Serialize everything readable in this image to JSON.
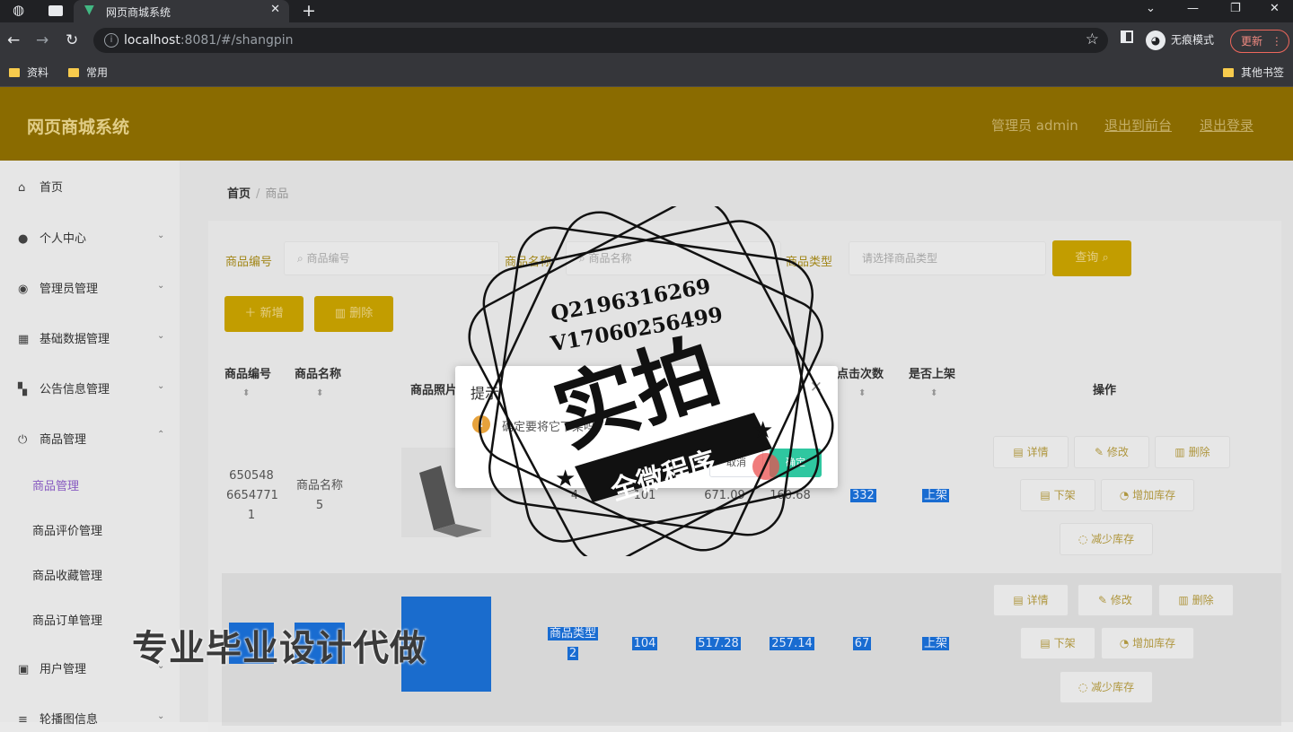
{
  "browser": {
    "tab_title": "网页商城系统",
    "url_host": "localhost",
    "url_rest": ":8081/#/shangpin",
    "incognito_label": "无痕模式",
    "update_label": "更新",
    "bookmarks": [
      "资料",
      "常用"
    ],
    "other_bookmarks": "其他书签"
  },
  "header": {
    "title": "网页商城系统",
    "admin": "管理员 admin",
    "back_front": "退出到前台",
    "logout": "退出登录"
  },
  "sidebar": {
    "items": [
      {
        "label": "首页",
        "icon": "home-icon"
      },
      {
        "label": "个人中心",
        "icon": "user-icon"
      },
      {
        "label": "管理员管理",
        "icon": "bulb-icon"
      },
      {
        "label": "基础数据管理",
        "icon": "grid-icon"
      },
      {
        "label": "公告信息管理",
        "icon": "apps-icon"
      },
      {
        "label": "商品管理",
        "icon": "power-icon"
      },
      {
        "label": "用户管理",
        "icon": "id-card-icon"
      },
      {
        "label": "轮播图信息",
        "icon": "menu-icon"
      }
    ],
    "sub_items": [
      "商品管理",
      "商品评价管理",
      "商品收藏管理",
      "商品订单管理"
    ]
  },
  "breadcrumb": {
    "home": "首页",
    "current": "商品"
  },
  "search": {
    "label_code": "商品编号",
    "placeholder_code": "商品编号",
    "label_name": "商品名称",
    "placeholder_name": "商品名称",
    "label_type": "商品类型",
    "placeholder_type": "请选择商品类型",
    "query_button": "查询"
  },
  "actions": {
    "add": "新增",
    "delete": "删除"
  },
  "table": {
    "headers": [
      "商品编号",
      "商品名称",
      "商品照片",
      "点击次数",
      "是否上架",
      "操作"
    ],
    "rows": [
      {
        "code": "1650548654771 1",
        "code_lines": [
          "650548",
          "6654771",
          "1"
        ],
        "name_lines": [
          "商品名称",
          "5"
        ],
        "type": "4",
        "stock": "101",
        "price": "671.09",
        "member_price": "160.68",
        "clicks": "332",
        "status": "上架"
      },
      {
        "code_lines": [
          "",
          ""
        ],
        "name_lines": [
          "",
          ""
        ],
        "type_lines": [
          "商品类型",
          "2"
        ],
        "stock": "104",
        "price": "517.28",
        "member_price": "257.14",
        "clicks": "67",
        "status": "上架"
      }
    ],
    "row_ops": [
      "详情",
      "修改",
      "删除",
      "下架",
      "增加库存",
      "减少库存"
    ]
  },
  "dialog": {
    "title": "提示",
    "message": "确定要将它下架吗?",
    "cancel": "取消",
    "confirm": "确定"
  },
  "watermark": {
    "stamp_lines": [
      "Q2196316269",
      "V17060256499",
      "实拍",
      "全微程序"
    ],
    "caption": "专业毕业设计代做"
  }
}
